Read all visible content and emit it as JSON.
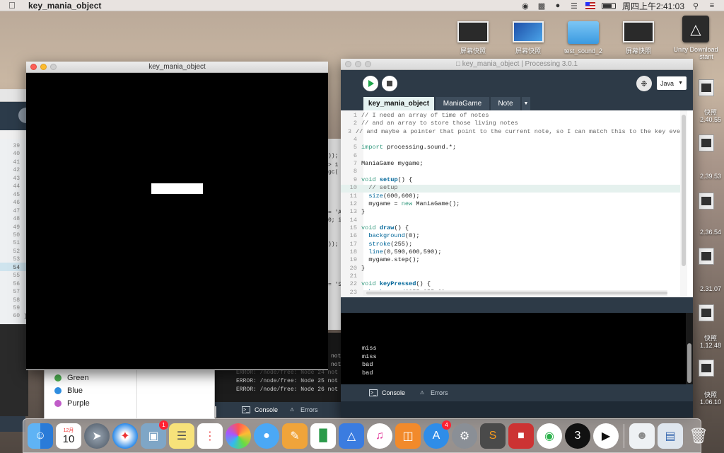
{
  "menubar": {
    "app_name": "key_mania_object",
    "clock": "周四上午2:41:03"
  },
  "desktop_icons": [
    {
      "label": "屏幕快照",
      "kind": "screenshot"
    },
    {
      "label": "屏幕快照",
      "kind": "win"
    },
    {
      "label": "test_sound_2",
      "kind": "folder"
    },
    {
      "label": "屏幕快照",
      "kind": "screenshot"
    },
    {
      "label": "Unity Download",
      "kind": "unity"
    }
  ],
  "desktop_icon_extra": "stant",
  "side_items": [
    {
      "label": "快照"
    },
    {
      "label": "2.40.55"
    },
    {
      "label": "2.39.53"
    },
    {
      "label": "2.36.54"
    },
    {
      "label": "2.31.07"
    },
    {
      "label": "快照"
    },
    {
      "label": "1.12.48"
    },
    {
      "label": "快照"
    },
    {
      "label": "1.06.10"
    }
  ],
  "bg_editor": {
    "gutter_numbers": [
      "39",
      "40",
      "41",
      "42",
      "43",
      "44",
      "45",
      "46",
      "47",
      "48",
      "49",
      "50",
      "51",
      "52",
      "53",
      "54",
      "55",
      "56",
      "57",
      "58",
      "59",
      "60"
    ],
    "current_line": "54",
    "closing_brace": "}",
    "peeks": [
      "));",
      "> 1",
      "gc(",
      "= 'A",
      "0; i",
      "));",
      "= 'S"
    ]
  },
  "color_list": [
    {
      "name": "Green",
      "color": "#4caf50"
    },
    {
      "name": "Blue",
      "color": "#2f8ee0"
    },
    {
      "name": "Purple",
      "color": "#c05cc8"
    }
  ],
  "bg_console": {
    "errors": [
      "ERROR: /node/free: Node 25 not",
      "ERROR: /node/free: Node 26 not"
    ],
    "faded_error": "ERROR: /node/free: Node 24 not",
    "error_suffixes": [
      "not",
      "not"
    ],
    "tab_console": "Console",
    "tab_errors": "Errors",
    "status_text": "设备"
  },
  "sketch": {
    "title": "key_mania_object"
  },
  "ide": {
    "title": "key_mania_object | Processing 3.0.1",
    "mode": "Java",
    "tabs": [
      "key_mania_object",
      "ManiaGame",
      "Note"
    ],
    "console_lines": [
      "miss",
      "miss",
      "bad",
      "bad"
    ],
    "console_tab": "Console",
    "errors_tab": "Errors",
    "code": [
      {
        "n": "1",
        "t": "// I need an array of time of notes"
      },
      {
        "n": "2",
        "t": "// and an array to store those living notes"
      },
      {
        "n": "3",
        "t": "// and maybe a pointer that point to the current note, so I can match this to the key eve"
      },
      {
        "n": "4",
        "t": ""
      },
      {
        "n": "5",
        "t": "import processing.sound.*;"
      },
      {
        "n": "6",
        "t": ""
      },
      {
        "n": "7",
        "t": "ManiaGame mygame;"
      },
      {
        "n": "8",
        "t": ""
      },
      {
        "n": "9",
        "t": "void setup() {"
      },
      {
        "n": "10",
        "t": "  // setup"
      },
      {
        "n": "11",
        "t": "  size(600,600);"
      },
      {
        "n": "12",
        "t": "  mygame = new ManiaGame();"
      },
      {
        "n": "13",
        "t": "}"
      },
      {
        "n": "14",
        "t": ""
      },
      {
        "n": "15",
        "t": "void draw() {"
      },
      {
        "n": "16",
        "t": "  background(0);"
      },
      {
        "n": "17",
        "t": "  stroke(255);"
      },
      {
        "n": "18",
        "t": "  line(0,590,600,590);"
      },
      {
        "n": "19",
        "t": "  mygame.step();"
      },
      {
        "n": "20",
        "t": "}"
      },
      {
        "n": "21",
        "t": ""
      },
      {
        "n": "22",
        "t": "void keyPressed() {"
      },
      {
        "n": "23",
        "t": "  background(255,255,0);"
      }
    ]
  },
  "dock": {
    "calendar_month": "12月",
    "calendar_day": "10",
    "badges": {
      "preview": "1",
      "appstore": "4"
    },
    "apps": [
      "finder-icon",
      "calendar-icon",
      "launchpad-icon",
      "safari-icon",
      "preview-icon",
      "notes-icon",
      "reminders-icon",
      "photos-icon",
      "messages-icon",
      "pages-icon",
      "numbers-icon",
      "keynote-icon",
      "itunes-icon",
      "ibooks-icon",
      "appstore-icon",
      "system-preferences-icon",
      "sublime-text-icon",
      "parallels-icon",
      "wechat-icon",
      "processing-icon",
      "quicktime-icon",
      "downloads-stack-icon",
      "documents-stack-icon",
      "trash-icon"
    ]
  }
}
